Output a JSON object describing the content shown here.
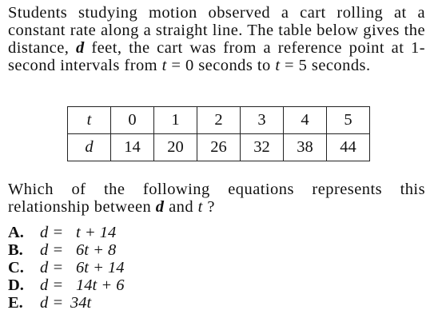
{
  "intro": {
    "before_d": "Students studying motion observed a cart rolling at a constant rate along a straight line. The table below gives the distance,",
    "d_var": "d",
    "middle": "feet, the cart was from a reference point at 1-second intervals from",
    "t_var1": "t",
    "range_start": "= 0 seconds to",
    "t_var2": "t",
    "range_end": "= 5 seconds."
  },
  "table": {
    "row_t": {
      "label": "t",
      "values": [
        "0",
        "1",
        "2",
        "3",
        "4",
        "5"
      ]
    },
    "row_d": {
      "label": "d",
      "values": [
        "14",
        "20",
        "26",
        "32",
        "38",
        "44"
      ]
    }
  },
  "question": {
    "before": "Which of the following equations represents this relationship between",
    "d_var": "d",
    "and": "and",
    "t_var": "t",
    "end": "?"
  },
  "choices": [
    {
      "letter": "A.",
      "lhs": "d =",
      "rhs": "t + 14"
    },
    {
      "letter": "B.",
      "lhs": "d =",
      "rhs": "6t + 8"
    },
    {
      "letter": "C.",
      "lhs": "d =",
      "rhs": "6t + 14"
    },
    {
      "letter": "D.",
      "lhs": "d =",
      "rhs": "14t + 6"
    },
    {
      "letter": "E.",
      "lhs": "d =",
      "rhs": "34t"
    }
  ]
}
